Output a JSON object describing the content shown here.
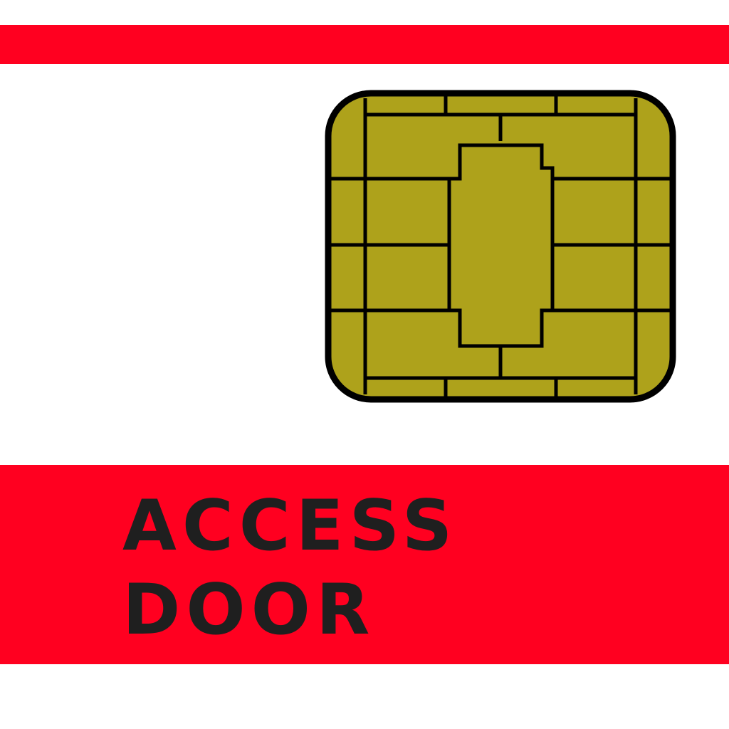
{
  "card": {
    "line1": "ACCESS",
    "line2": "DOOR"
  },
  "icons": {
    "chip": "smart-card-chip-icon"
  },
  "colors": {
    "background": "#ffffff",
    "stripe": "#ff0020",
    "chip_gold": "#aea21b",
    "chip_outline": "#000000",
    "text": "#1f1f1f"
  }
}
